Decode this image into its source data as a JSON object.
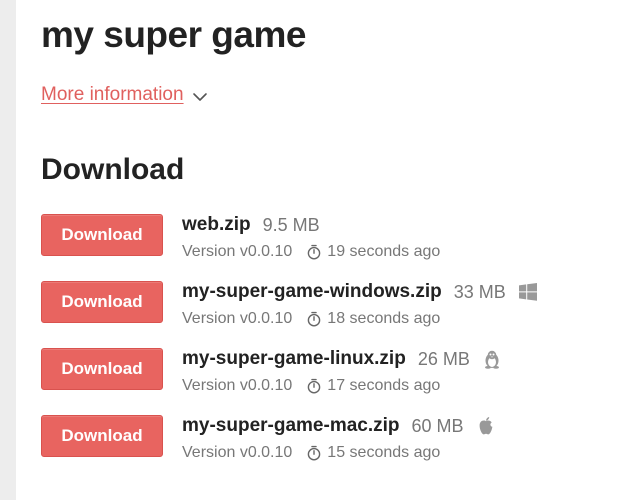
{
  "game": {
    "title": "my super game",
    "more_info_label": "More information"
  },
  "download_section": {
    "title": "Download",
    "button_label": "Download",
    "uploads": [
      {
        "name": "web.zip",
        "size": "9.5 MB",
        "version": "Version v0.0.10",
        "time": "19 seconds ago",
        "platform_icon": ""
      },
      {
        "name": "my-super-game-windows.zip",
        "size": "33 MB",
        "version": "Version v0.0.10",
        "time": "18 seconds ago",
        "platform_icon": "windows-icon"
      },
      {
        "name": "my-super-game-linux.zip",
        "size": "26 MB",
        "version": "Version v0.0.10",
        "time": "17 seconds ago",
        "platform_icon": "linux-icon"
      },
      {
        "name": "my-super-game-mac.zip",
        "size": "60 MB",
        "version": "Version v0.0.10",
        "time": "15 seconds ago",
        "platform_icon": "apple-icon"
      }
    ]
  },
  "colors": {
    "accent": "#e86460",
    "link": "#e0605e",
    "muted_text": "#777777",
    "sidebar_bg": "#ededed"
  }
}
